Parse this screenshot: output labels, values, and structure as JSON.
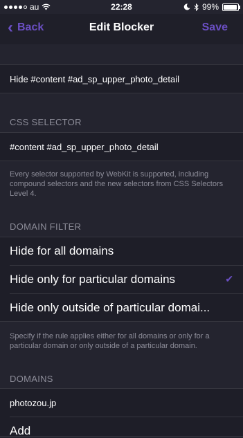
{
  "status_bar": {
    "carrier": "au",
    "time": "22:28",
    "battery": "99%"
  },
  "nav": {
    "back_label": "Back",
    "title": "Edit Blocker",
    "save_label": "Save"
  },
  "rule_name": "Hide #content #ad_sp_upper_photo_detail",
  "css_selector": {
    "header": "CSS SELECTOR",
    "value": "#content #ad_sp_upper_photo_detail",
    "footer": "Every selector supported by WebKit is supported, including compound selectors and the new selectors from CSS Selectors Level 4."
  },
  "domain_filter": {
    "header": "DOMAIN FILTER",
    "options": [
      {
        "label": "Hide for all domains",
        "selected": false
      },
      {
        "label": "Hide only for particular domains",
        "selected": true
      },
      {
        "label": "Hide only outside of particular domai...",
        "selected": false
      }
    ],
    "footer": "Specify if the rule applies either for all domains or only for a particular domain or only outside of a particular domain."
  },
  "domains": {
    "header": "DOMAINS",
    "items": [
      "photozou.jp"
    ],
    "add_label": "Add"
  },
  "colors": {
    "accent": "#6b4fc4",
    "background": "#24242f",
    "cell": "#1e1e28",
    "secondary_text": "#8d8d99"
  }
}
